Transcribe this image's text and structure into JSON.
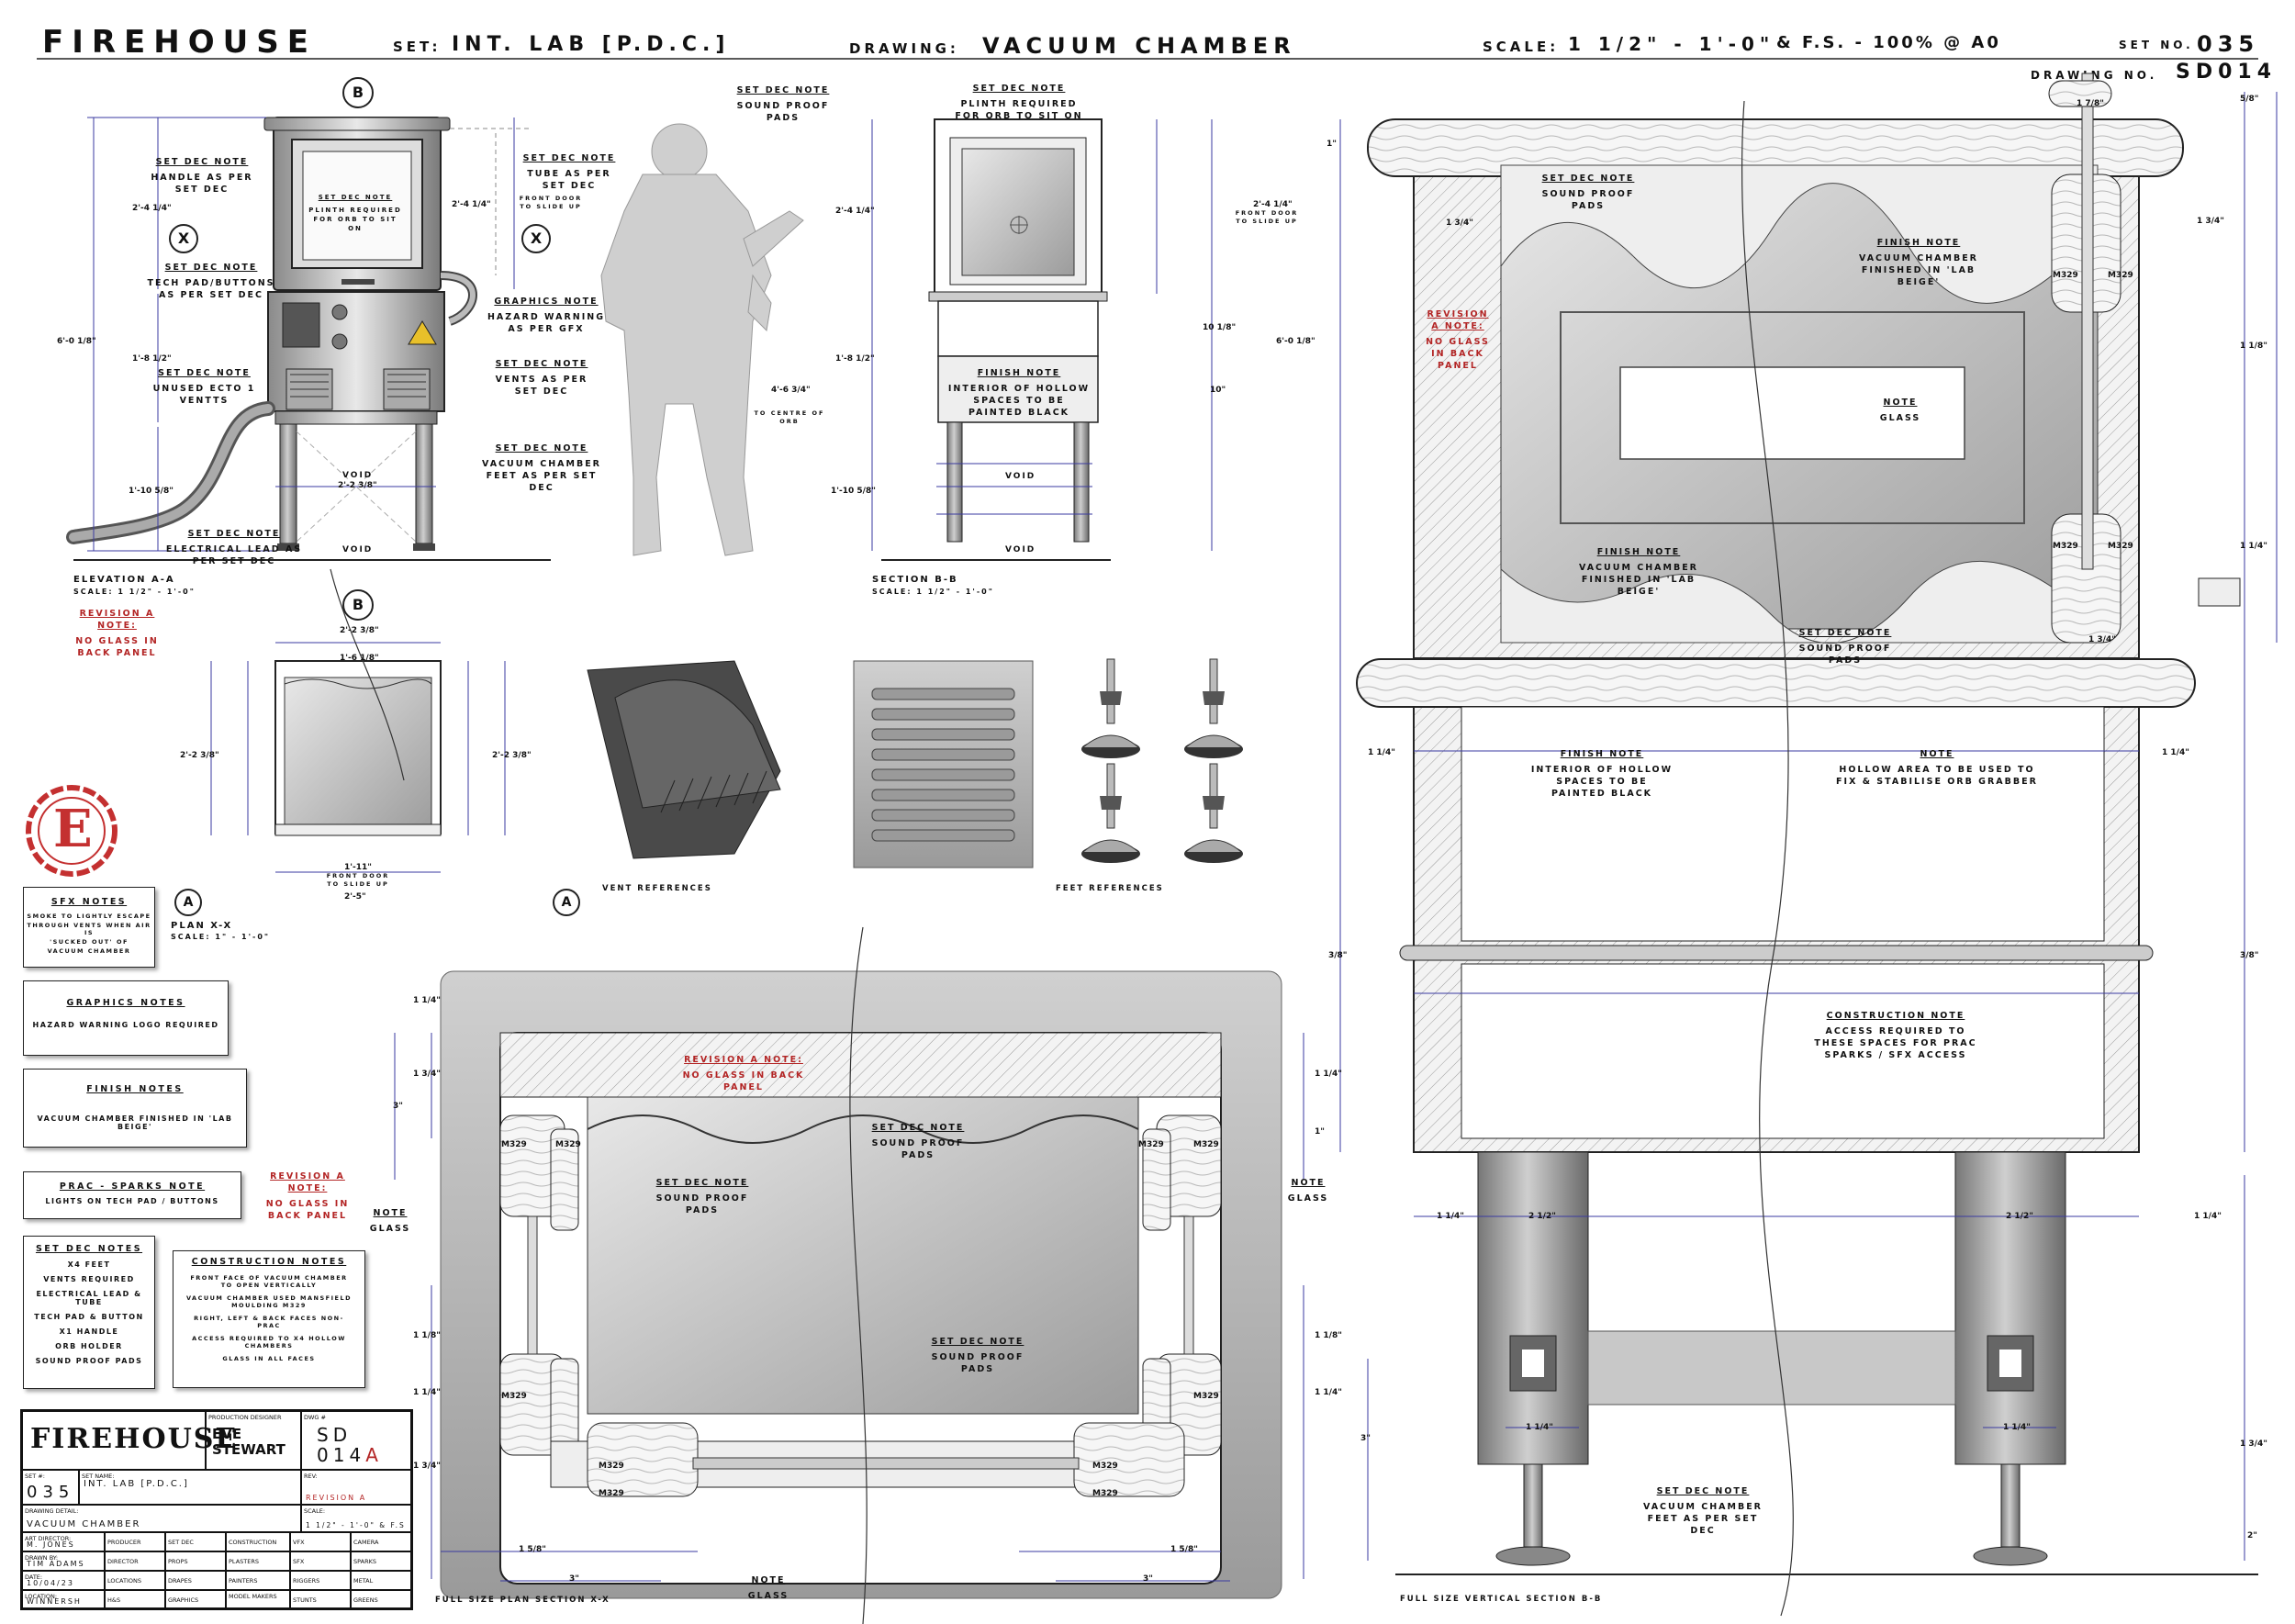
{
  "header": {
    "title": "FIREHOUSE",
    "set_label": "SET:",
    "set_value": "INT. LAB [P.D.C.]",
    "drawing_label": "DRAWING:",
    "drawing_value": "VACUUM CHAMBER",
    "scale_label": "SCALE:",
    "scale_value": "1 1/2\" - 1'-0\"",
    "scale_extra": "& F.S. - 100% @ A0",
    "set_no_label": "SET NO.",
    "set_no": "035",
    "drawing_no_label": "DRAWING NO.",
    "drawing_no": "SD014"
  },
  "captions": {
    "elev_a": "ELEVATION A-A",
    "elev_a_scale": "SCALE: 1 1/2\" - 1'-0\"",
    "section_b": "SECTION B-B",
    "section_b_scale": "SCALE: 1 1/2\" - 1'-0\"",
    "plan_x": "PLAN X-X",
    "plan_x_scale": "SCALE: 1\" - 1'-0\"",
    "vent_refs": "VENT REFERENCES",
    "feet_refs": "FEET REFERENCES",
    "fs_plan": "FULL SIZE PLAN SECTION X-X",
    "fs_vertical": "FULL SIZE VERTICAL SECTION B-B"
  },
  "markers": {
    "b": "B",
    "x": "X",
    "a": "A",
    "stamp": "E",
    "void": "VOID"
  },
  "notes": {
    "handle_title": "SET DEC NOTE",
    "handle": "HANDLE AS PER SET DEC",
    "techpad_title": "SET DEC NOTE",
    "techpad": "TECH PAD/BUTTONS AS PER SET DEC",
    "vents_title": "SET DEC NOTE",
    "vents": "UNUSED ECTO 1 VENTTS",
    "lead_title": "SET DEC NOTE",
    "lead": "ELECTRICAL LEAD AS PER SET DEC",
    "tube_title": "SET DEC NOTE",
    "tube": "TUBE AS PER SET DEC",
    "hazard_title": "GRAPHICS NOTE",
    "hazard": "HAZARD WARNING AS PER GFX",
    "ventspec_title": "SET DEC NOTE",
    "ventspec": "VENTS AS PER SET DEC",
    "feet_title": "SET DEC NOTE",
    "feet": "VACUUM CHAMBER FEET AS PER SET DEC",
    "window_title": "SET DEC NOTE",
    "window": "PLINTH REQUIRED FOR ORB TO SIT ON",
    "pads_title": "SET DEC NOTE",
    "pads": "SOUND PROOF PADS",
    "plinth_title": "SET DEC NOTE",
    "plinth": "PLINTH REQUIRED FOR ORB TO SIT ON",
    "hollow_title": "FINISH NOTE",
    "hollow": "INTERIOR OF HOLLOW SPACES TO BE PAINTED BLACK",
    "frontdoor": "FRONT DOOR TO SLIDE UP",
    "centre_orb": "TO CENTRE OF ORB",
    "rev_a_title": "REVISION A NOTE:",
    "rev_a": "NO GLASS IN BACK PANEL",
    "finish_beige_title": "FINISH NOTE",
    "finish_beige": "VACUUM CHAMBER FINISHED IN 'LAB BEIGE'",
    "glass_title": "NOTE",
    "glass": "GLASS",
    "fix_title": "NOTE",
    "fix": "HOLLOW AREA TO BE USED TO FIX & STABILISE ORB GRABBER",
    "access_title": "CONSTRUCTION NOTE",
    "access": "ACCESS REQUIRED TO THESE SPACES FOR PRAC SPARKS / SFX ACCESS",
    "mould": "M329"
  },
  "side_boxes": {
    "sfx": {
      "title": "SFX NOTES",
      "lines": [
        "SMOKE TO LIGHTLY ESCAPE",
        "THROUGH VENTS WHEN AIR IS",
        "'SUCKED OUT' OF",
        "VACUUM CHAMBER"
      ]
    },
    "graphics": {
      "title": "GRAPHICS NOTES",
      "lines": [
        "HAZARD WARNING LOGO REQUIRED"
      ]
    },
    "finish": {
      "title": "FINISH NOTES",
      "lines": [
        "VACUUM CHAMBER FINISHED IN 'LAB BEIGE'"
      ]
    },
    "prac": {
      "title": "PRAC - SPARKS NOTE",
      "lines": [
        "LIGHTS ON TECH PAD / BUTTONS"
      ]
    },
    "setdec": {
      "title": "SET DEC NOTES",
      "lines": [
        "X4 FEET",
        "VENTS REQUIRED",
        "ELECTRICAL LEAD & TUBE",
        "TECH PAD & BUTTON",
        "X1 HANDLE",
        "ORB HOLDER",
        "SOUND PROOF PADS"
      ]
    },
    "construction": {
      "title": "CONSTRUCTION NOTES",
      "lines": [
        "FRONT FACE OF VACUUM CHAMBER TO OPEN VERTICALLY",
        "VACUUM CHAMBER USED MANSFIELD MOULDING M329",
        "RIGHT, LEFT & BACK FACES NON-PRAC",
        "ACCESS REQUIRED TO X4 HOLLOW CHAMBERS",
        "GLASS IN ALL FACES"
      ]
    },
    "rev_side_title": "REVISION A NOTE:",
    "rev_side": "NO GLASS IN BACK PANEL"
  },
  "title_block": {
    "logo": "FIREHOUSE",
    "designer_label": "PRODUCTION DESIGNER",
    "designer": "EVE STEWART",
    "dwg_label": "DWG #",
    "dwg": "SD 014",
    "dwg_rev": "A",
    "set_no_label": "SET #:",
    "set_no": "035",
    "set_name_label": "SET NAME:",
    "set_name": "INT. LAB [P.D.C.]",
    "rev_label": "REV:",
    "rev": "REVISION A",
    "detail_label": "DRAWING DETAIL:",
    "detail": "VACUUM CHAMBER",
    "scale_label": "SCALE:",
    "scale": "1 1/2\" - 1'-0\" & F.S",
    "art_label": "ART DIRECTOR:",
    "art": "M. JONES",
    "drawn_label": "DRAWN BY:",
    "drawn": "TIM ADAMS",
    "date_label": "DATE:",
    "date": "10/04/23",
    "loc_label": "LOCATION:",
    "loc": "WINNERSH",
    "depts": [
      "PRODUCER",
      "SET DEC",
      "CONSTRUCTION",
      "VFX",
      "CAMERA",
      "DIRECTOR",
      "PROPS",
      "PLASTERS",
      "SFX",
      "SPARKS",
      "LOCATIONS",
      "DRAPES",
      "PAINTERS",
      "RIGGERS",
      "METAL",
      "H&S",
      "GRAPHICS",
      "MODEL MAKERS",
      "STUNTS",
      "GREENS"
    ]
  },
  "dims": {
    "h60": "6'-0 1/8\"",
    "h18": "1'-8 1/2\"",
    "h110": "1'-10 5/8\"",
    "h24": "2'-4 1/4\"",
    "w22": "2'-2 3/8\"",
    "w25": "2'-5\"",
    "w111": "1'-11\"",
    "w16": "1'-6 1/8\"",
    "d1": "1\"",
    "d114": "1 1/4\"",
    "d118": "1 1/8\"",
    "d134": "1 3/4\"",
    "d3": "3\"",
    "d38": "3/8\"",
    "d58": "5/8\"",
    "d212": "2 1/2\"",
    "d2": "2\"",
    "d178": "1 7/8\"",
    "d158": "1 5/8\"",
    "d10": "10\"",
    "d1018": "10 1/8\"",
    "d4": "4'-6 3/4\""
  }
}
